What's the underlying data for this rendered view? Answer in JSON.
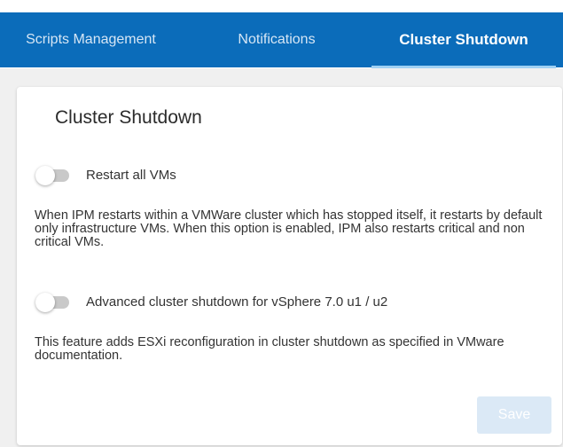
{
  "tabs": [
    {
      "label": "Scripts Management"
    },
    {
      "label": "Notifications"
    },
    {
      "label": "Cluster Shutdown",
      "active": true
    }
  ],
  "card": {
    "title": "Cluster Shutdown",
    "restart_vms": {
      "label": "Restart all VMs",
      "enabled": false,
      "description": "When IPM restarts within a VMWare cluster which has stopped itself, it restarts by default only infrastructure VMs. When this option is enabled, IPM also restarts critical and non critical VMs."
    },
    "advanced_shutdown": {
      "label": "Advanced cluster shutdown for vSphere 7.0 u1 / u2",
      "enabled": false,
      "description": "This feature adds ESXi reconfiguration in cluster shutdown as specified in VMware documentation."
    },
    "save_label": "Save"
  },
  "colors": {
    "tab_bar": "#0b6cba",
    "tab_indicator": "#9fd0f3",
    "toggle_track_off": "#c9c9c9",
    "save_disabled": "#dbe9f6"
  }
}
